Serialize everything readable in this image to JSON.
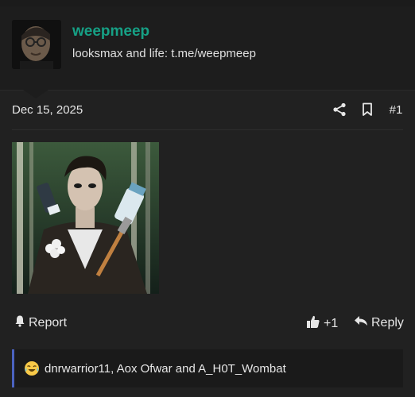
{
  "user": {
    "name": "weepmeep",
    "bio": "looksmax and life: t.me/weepmeep"
  },
  "post": {
    "date": "Dec 15, 2025",
    "number": "#1",
    "icons": [
      "share-icon",
      "bookmark-icon"
    ]
  },
  "actions": {
    "report_label": "Report",
    "like_count": "+1",
    "reply_label": "Reply"
  },
  "reactions": {
    "emoji": "crying-laughing-face",
    "text": "dnrwarrior11, Aox Ofwar and A_H0T_Wombat"
  },
  "colors": {
    "accent": "#16a085",
    "reaction_bar": "#4b63c0",
    "background": "#212121"
  }
}
